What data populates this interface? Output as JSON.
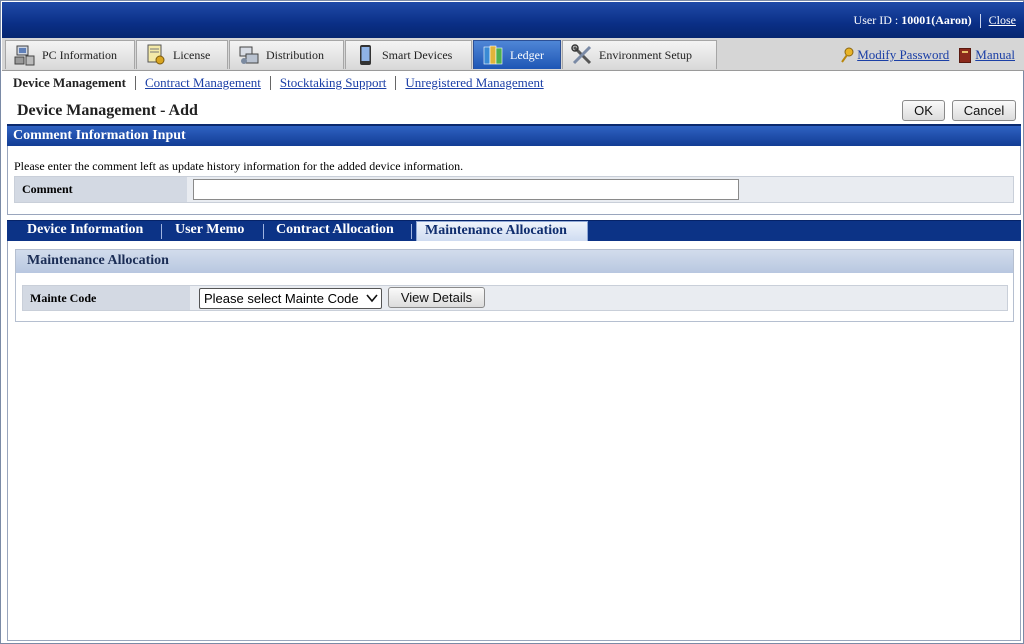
{
  "header": {
    "user_id_label": "User ID :",
    "user_id_value": "10001(Aaron)",
    "close_label": "Close"
  },
  "main_tabs": [
    {
      "label": "PC Information",
      "icon": "pc-icon"
    },
    {
      "label": "License",
      "icon": "license-icon"
    },
    {
      "label": "Distribution",
      "icon": "distribution-icon"
    },
    {
      "label": "Smart Devices",
      "icon": "smartphone-icon"
    },
    {
      "label": "Ledger",
      "icon": "ledger-icon",
      "active": true
    },
    {
      "label": "Environment Setup",
      "icon": "tools-icon"
    }
  ],
  "top_links": {
    "modify_password": "Modify Password",
    "manual": "Manual"
  },
  "subnav": {
    "current": "Device Management",
    "links": [
      "Contract Management",
      "Stocktaking Support",
      "Unregistered Management"
    ]
  },
  "page": {
    "title": "Device Management - Add",
    "ok_label": "OK",
    "cancel_label": "Cancel"
  },
  "comment_section": {
    "title": "Comment Information Input",
    "hint": "Please enter the comment left as update history information for the added device information.",
    "field_label": "Comment",
    "field_value": ""
  },
  "lower_tabs": [
    {
      "label": "Device Information"
    },
    {
      "label": "User Memo"
    },
    {
      "label": "Contract Allocation"
    },
    {
      "label": "Maintenance Allocation",
      "active": true
    }
  ],
  "maintenance": {
    "title": "Maintenance Allocation",
    "field_label": "Mainte Code",
    "select_value": "Please select Mainte Code",
    "view_details_label": "View Details"
  },
  "colors": {
    "header_blue": "#0a2f86",
    "active_tab_blue": "#1e56b5",
    "link_blue": "#1b3fa6",
    "label_bg": "#d3d9e3"
  }
}
